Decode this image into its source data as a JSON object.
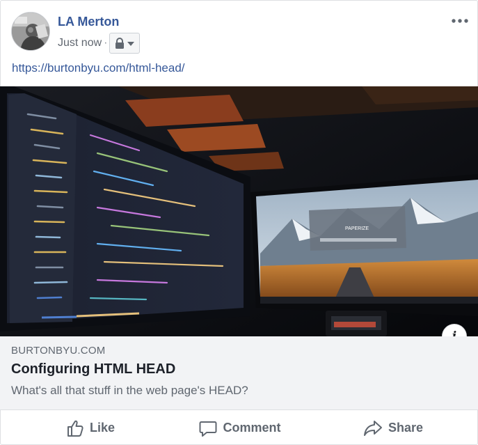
{
  "post": {
    "author": "LA Merton",
    "timestamp": "Just now",
    "separator": "·",
    "privacy_icon": "lock-icon",
    "more_icon": "more-options-icon",
    "link_url": "https://burtonbyu.com/html-head/"
  },
  "hero_image": {
    "screen_text": "PAPERIZE"
  },
  "link_preview": {
    "domain": "BURTONBYU.COM",
    "title": "Configuring HTML HEAD",
    "description": "What's all that stuff in the web page's HEAD?",
    "info_label": "i"
  },
  "actions": {
    "like": "Like",
    "comment": "Comment",
    "share": "Share"
  },
  "colors": {
    "author": "#365899",
    "link": "#365899",
    "preview_bg": "#f2f3f5",
    "action_text": "#606770"
  }
}
